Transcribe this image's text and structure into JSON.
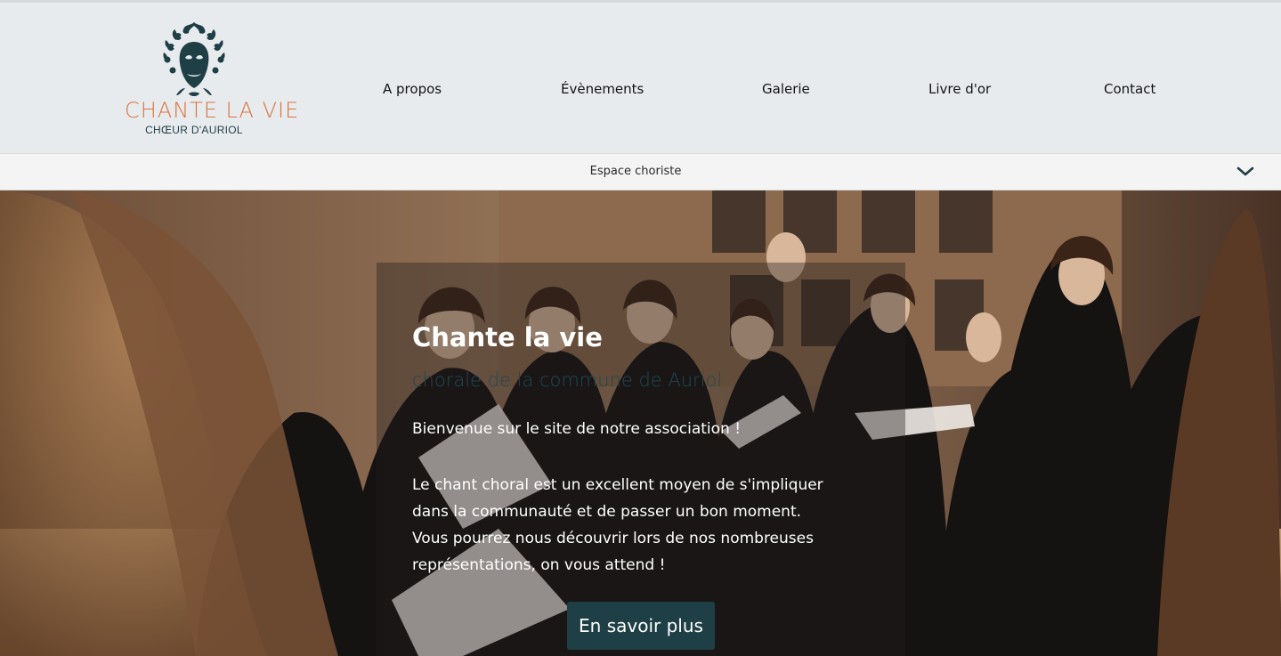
{
  "brand": {
    "name": "CHANTE LA VIE",
    "subtitle": "CHŒUR D'AURIOL",
    "icon": "mask-vine-logo-icon",
    "colors": {
      "name": "#d9733f",
      "dark": "#1f3f46"
    }
  },
  "nav": {
    "items": [
      {
        "label": "A propos"
      },
      {
        "label": "Évènements"
      },
      {
        "label": "Galerie"
      },
      {
        "label": "Livre d'or"
      },
      {
        "label": "Contact"
      }
    ]
  },
  "member_bar": {
    "label": "Espace choriste",
    "icon": "chevron-down-icon"
  },
  "hero": {
    "title": "Chante la vie",
    "subtitle": "chorale de la commune de Auriol",
    "welcome": "Bienvenue sur le site de notre association !",
    "body_lines": [
      "Le chant choral est un excellent moyen de s'impliquer",
      "dans la communauté et de passer un bon moment.",
      "Vous pourrez nous découvrir lors de nos nombreuses",
      "représentations, on vous attend !"
    ],
    "cta_label": "En savoir plus",
    "cta_color": "#1f3f46"
  }
}
